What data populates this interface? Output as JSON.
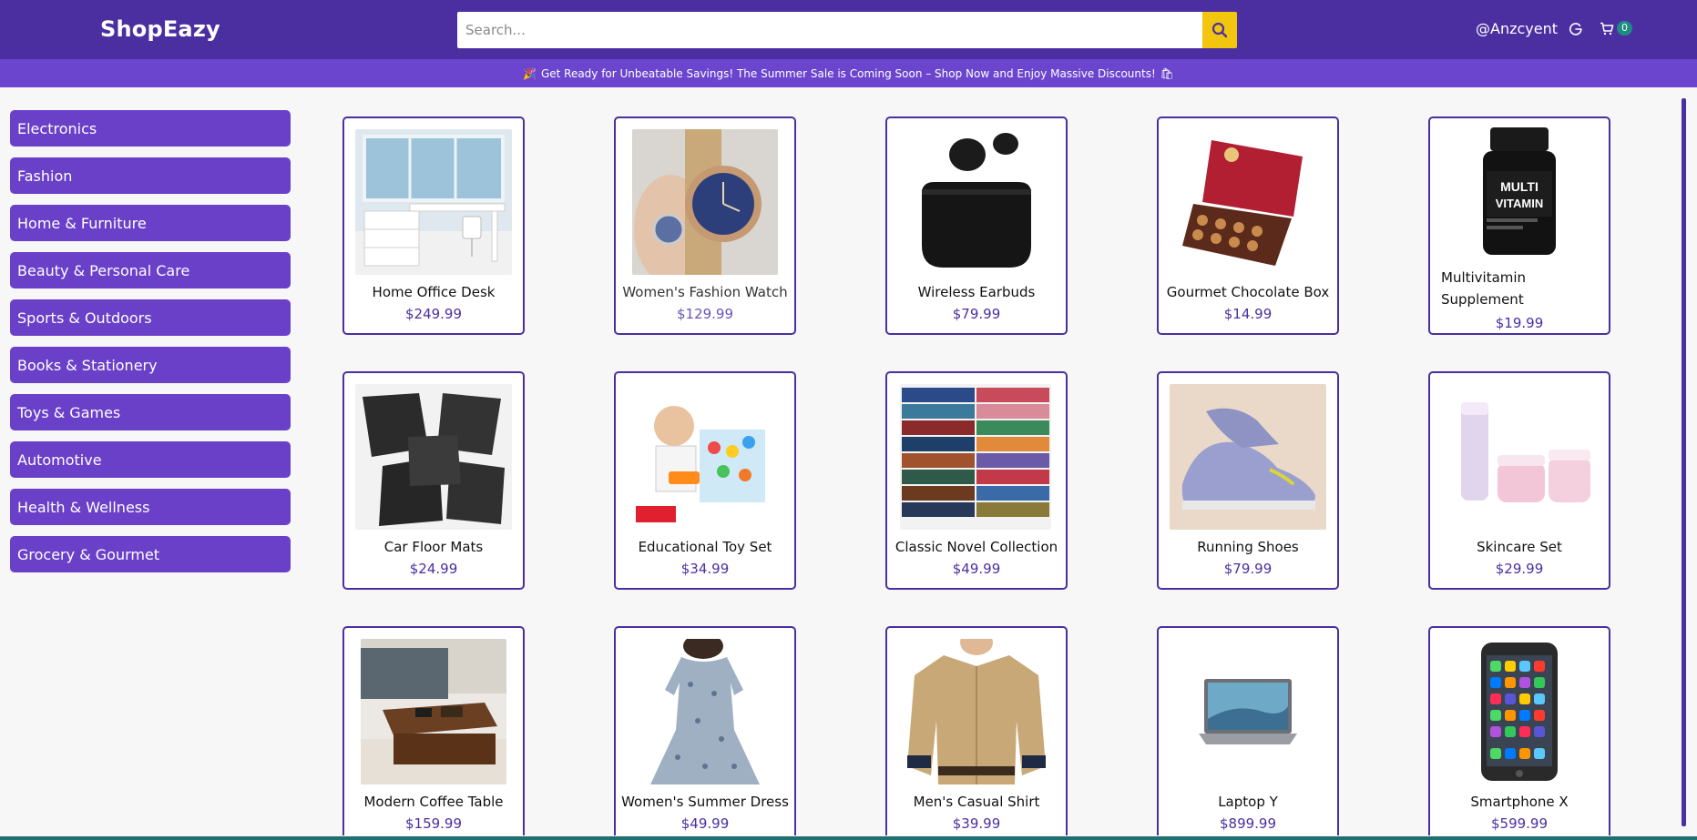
{
  "header": {
    "logo": "ShopEazy",
    "search_placeholder": "Search...",
    "username": "@Anzcyent",
    "cart_count": "0"
  },
  "announcement": {
    "prefix_icon": "party-popper-icon",
    "text": "Get Ready for Unbeatable Savings! The Summer Sale is Coming Soon – Shop Now and Enjoy Massive Discounts!",
    "suffix_icon": "shopping-bags-icon"
  },
  "categories": [
    "Electronics",
    "Fashion",
    "Home & Furniture",
    "Beauty & Personal Care",
    "Sports & Outdoors",
    "Books & Stationery",
    "Toys & Games",
    "Automotive",
    "Health & Wellness",
    "Grocery & Gourmet"
  ],
  "products": [
    {
      "name": "Home Office Desk",
      "price": "$249.99",
      "icon": "desk-icon"
    },
    {
      "name": "Women's Fashion Watch",
      "price": "$129.99",
      "icon": "watch-icon"
    },
    {
      "name": "Wireless Earbuds",
      "price": "$79.99",
      "icon": "earbuds-icon"
    },
    {
      "name": "Gourmet Chocolate Box",
      "price": "$14.99",
      "icon": "chocolate-box-icon"
    },
    {
      "name": "Multivitamin Supplement",
      "price": "$19.99",
      "icon": "vitamin-bottle-icon"
    },
    {
      "name": "Car Floor Mats",
      "price": "$24.99",
      "icon": "floor-mats-icon"
    },
    {
      "name": "Educational Toy Set",
      "price": "$34.99",
      "icon": "toy-set-icon"
    },
    {
      "name": "Classic Novel Collection",
      "price": "$49.99",
      "icon": "books-icon"
    },
    {
      "name": "Running Shoes",
      "price": "$79.99",
      "icon": "shoes-icon"
    },
    {
      "name": "Skincare Set",
      "price": "$29.99",
      "icon": "skincare-icon"
    },
    {
      "name": "Modern Coffee Table",
      "price": "$159.99",
      "icon": "coffee-table-icon"
    },
    {
      "name": "Women's Summer Dress",
      "price": "$49.99",
      "icon": "dress-icon"
    },
    {
      "name": "Men's Casual Shirt",
      "price": "$39.99",
      "icon": "shirt-icon"
    },
    {
      "name": "Laptop Y",
      "price": "$899.99",
      "icon": "laptop-icon"
    },
    {
      "name": "Smartphone X",
      "price": "$599.99",
      "icon": "smartphone-icon"
    }
  ],
  "colors": {
    "brand": "#4b2fa0",
    "announcement": "#6c45cf",
    "category": "#6a40c8",
    "search_button": "#f2c50f",
    "cart_badge": "#1f8c84"
  }
}
